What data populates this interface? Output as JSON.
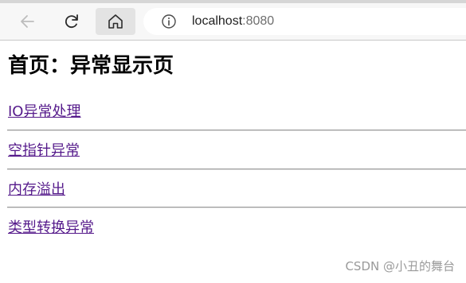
{
  "browser": {
    "back_icon": "back-arrow-icon",
    "reload_icon": "reload-icon",
    "home_icon": "home-icon",
    "info_icon": "info-icon",
    "url_host": "localhost",
    "url_port": ":8080"
  },
  "page": {
    "title": "首页：异常显示页",
    "links": [
      "IO异常处理",
      "空指针异常",
      "内存溢出",
      "类型转换异常"
    ],
    "link_color": "#551a8b"
  },
  "watermark": "CSDN @小丑的舞台"
}
